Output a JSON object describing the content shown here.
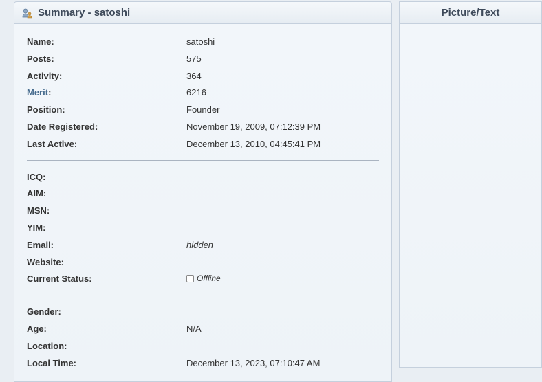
{
  "header": {
    "summary_title": "Summary - satoshi",
    "picture_text_title": "Picture/Text"
  },
  "labels": {
    "name": "Name:",
    "posts": "Posts:",
    "activity": "Activity:",
    "merit": "Merit",
    "merit_colon": ":",
    "position": "Position:",
    "date_registered": "Date Registered:",
    "last_active": "Last Active:",
    "icq": "ICQ:",
    "aim": "AIM:",
    "msn": "MSN:",
    "yim": "YIM:",
    "email": "Email:",
    "website": "Website:",
    "current_status": "Current Status:",
    "gender": "Gender:",
    "age": "Age:",
    "location": "Location:",
    "local_time": "Local Time:"
  },
  "values": {
    "name": "satoshi",
    "posts": "575",
    "activity": "364",
    "merit": "6216",
    "position": "Founder",
    "date_registered": "November 19, 2009, 07:12:39 PM",
    "last_active": "December 13, 2010, 04:45:41 PM",
    "icq": "",
    "aim": "",
    "msn": "",
    "yim": "",
    "email": "hidden",
    "website": "",
    "status_text": "Offline",
    "gender": "",
    "age": "N/A",
    "location": "",
    "local_time": "December 13, 2023, 07:10:47 AM"
  }
}
